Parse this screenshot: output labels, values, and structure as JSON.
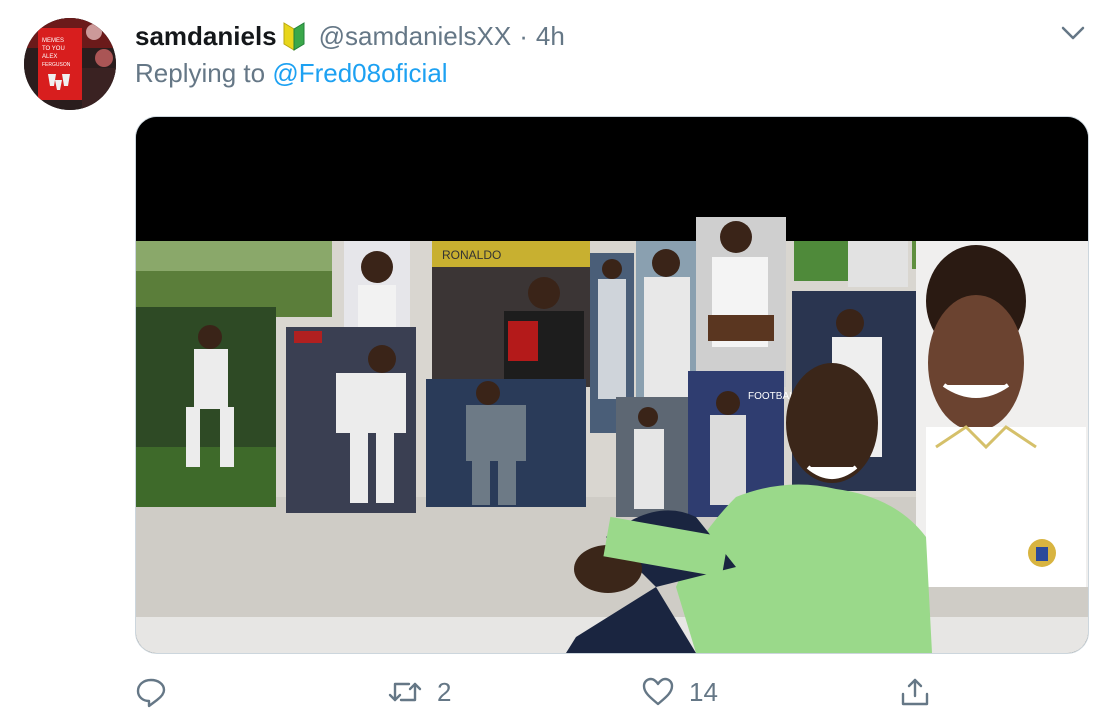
{
  "tweet": {
    "author": {
      "display_name": "samdaniels",
      "badge_icon": "beginner-leaf-icon",
      "handle": "@samdanielsXX",
      "separator": "·",
      "timestamp": "4h",
      "avatar_text": [
        "MEMES",
        "TO YOU",
        "ALEX",
        "FERGUSON"
      ]
    },
    "replying": {
      "prefix": "Replying to",
      "mention": "@Fred08oficial"
    },
    "media": {
      "poster_texts": [
        "RONALDO",
        "FOOTBALL"
      ]
    },
    "actions": {
      "reply": {
        "icon": "reply-icon"
      },
      "retweet": {
        "icon": "retweet-icon",
        "count": "2"
      },
      "like": {
        "icon": "heart-icon",
        "count": "14"
      },
      "share": {
        "icon": "share-icon"
      }
    }
  },
  "colors": {
    "text": "#14171a",
    "secondary": "#657786",
    "link": "#1da1f2",
    "border": "#ccd6dd"
  }
}
